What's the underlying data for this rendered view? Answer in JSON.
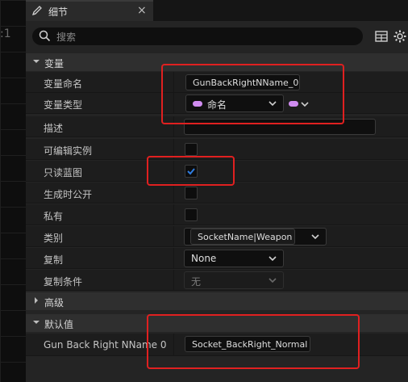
{
  "background": {
    "zoom_text": ":1"
  },
  "tab": {
    "title": "细节",
    "close": "×"
  },
  "search": {
    "placeholder": "搜索"
  },
  "sections": {
    "variables": "变量",
    "advanced": "高级",
    "default_value": "默认值"
  },
  "rows": {
    "var_name": {
      "label": "变量命名",
      "value": "GunBackRightNName_0"
    },
    "var_type": {
      "label": "变量类型",
      "value": "命名"
    },
    "description": {
      "label": "描述",
      "value": ""
    },
    "instance_editable": {
      "label": "可编辑实例",
      "checked": false
    },
    "blueprint_readonly": {
      "label": "只读蓝图",
      "checked": true
    },
    "expose_on_spawn": {
      "label": "生成时公开",
      "checked": false
    },
    "private": {
      "label": "私有",
      "checked": false
    },
    "category": {
      "label": "类别",
      "value": "SocketName|Weapon"
    },
    "replication": {
      "label": "复制",
      "value": "None"
    },
    "replication_condition": {
      "label": "复制条件",
      "value": "无"
    },
    "default": {
      "label": "Gun Back Right NName 0",
      "value": "Socket_BackRight_Normal"
    }
  },
  "colors": {
    "accent": "#2f7de1",
    "name_type": "#d08cf0",
    "highlight": "#e02020"
  }
}
